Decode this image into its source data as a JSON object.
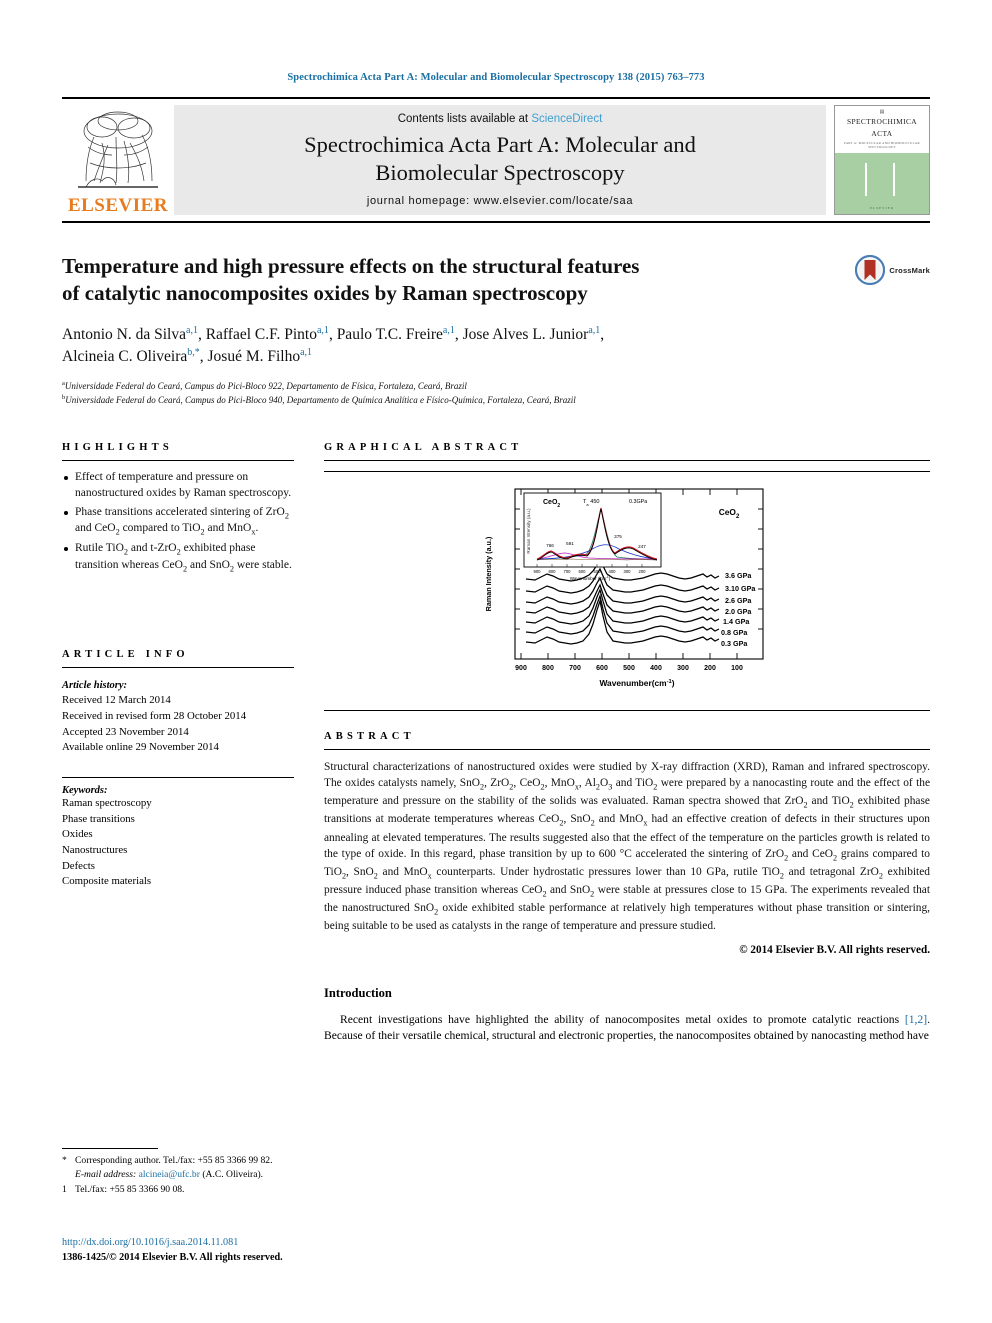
{
  "running_head": "Spectrochimica Acta Part A: Molecular and Biomolecular Spectroscopy 138 (2015) 763–773",
  "masthead": {
    "publisher": "ELSEVIER",
    "contents_prefix": "Contents lists available at ",
    "contents_link": "ScienceDirect",
    "journal_title_line1": "Spectrochimica Acta Part A: Molecular and",
    "journal_title_line2": "Biomolecular Spectroscopy",
    "homepage": "journal homepage: www.elsevier.com/locate/saa",
    "cover": {
      "title_line1": "SPECTROCHIMICA",
      "title_line2": "ACTA",
      "subtitle": "PART A: MOLECULAR AND BIOMOLECULAR SPECTROSCOPY",
      "footer": "ELSEVIER"
    }
  },
  "article": {
    "title_line1": "Temperature and high pressure effects on the structural features",
    "title_line2": "of catalytic nanocomposites oxides by Raman spectroscopy",
    "crossmark_label": "CrossMark",
    "authors": [
      {
        "name": "Antonio N. da Silva",
        "marks": "a,1",
        "sep": ", "
      },
      {
        "name": "Raffael C.F. Pinto",
        "marks": "a,1",
        "sep": ", "
      },
      {
        "name": "Paulo T.C. Freire",
        "marks": "a,1",
        "sep": ", "
      },
      {
        "name": "Jose Alves L. Junior",
        "marks": "a,1",
        "sep": ", "
      },
      {
        "name": "Alcineia C. Oliveira",
        "marks": "b,*",
        "sep": ", "
      },
      {
        "name": "Josué M. Filho",
        "marks": "a,1",
        "sep": ""
      }
    ],
    "affiliations": [
      {
        "mark": "a",
        "text": "Universidade Federal do Ceará, Campus do Pici-Bloco 922, Departamento de Física, Fortaleza, Ceará, Brazil"
      },
      {
        "mark": "b",
        "text": "Universidade Federal do Ceará, Campus do Pici-Bloco 940, Departamento de Química Analítica e Físico-Química, Fortaleza, Ceará, Brazil"
      }
    ]
  },
  "highlights": {
    "heading": "HIGHLIGHTS",
    "items": [
      "Effect of temperature and pressure on nanostructured oxides by Raman spectroscopy.",
      "Phase transitions accelerated sintering of ZrO2 and CeO2 compared to TiO2 and MnOx.",
      "Rutile TiO2 and t-ZrO2 exhibited phase transition whereas CeO2 and SnO2 were stable."
    ]
  },
  "graphical_abstract": {
    "heading": "GRAPHICAL ABSTRACT"
  },
  "article_info": {
    "heading": "ARTICLE INFO",
    "history_label": "Article history:",
    "history": [
      "Received 12 March 2014",
      "Received in revised form 28 October 2014",
      "Accepted 23 November 2014",
      "Available online 29 November 2014"
    ],
    "keywords_label": "Keywords:",
    "keywords": [
      "Raman spectroscopy",
      "Phase transitions",
      "Oxides",
      "Nanostructures",
      "Defects",
      "Composite materials"
    ]
  },
  "abstract": {
    "heading": "ABSTRACT",
    "body": "Structural characterizations of nanostructured oxides were studied by X-ray diffraction (XRD), Raman and infrared spectroscopy. The oxides catalysts namely, SnO2, ZrO2, CeO2, MnOx, Al2O3 and TiO2 were prepared by a nanocasting route and the effect of the temperature and pressure on the stability of the solids was evaluated. Raman spectra showed that ZrO2 and TiO2 exhibited phase transitions at moderate temperatures whereas CeO2, SnO2 and MnOx had an effective creation of defects in their structures upon annealing at elevated temperatures. The results suggested also that the effect of the temperature on the particles growth is related to the type of oxide. In this regard, phase transition by up to 600 °C accelerated the sintering of ZrO2 and CeO2 grains compared to TiO2, SnO2 and MnOx counterparts. Under hydrostatic pressures lower than 10 GPa, rutile TiO2 and tetragonal ZrO2 exhibited pressure induced phase transition whereas CeO2 and SnO2 were stable at pressures close to 15 GPa. The experiments revealed that the nanostructured SnO2 oxide exhibited stable performance at relatively high temperatures without phase transition or sintering, being suitable to be used as catalysts in the range of temperature and pressure studied.",
    "copyright": "© 2014 Elsevier B.V. All rights reserved."
  },
  "introduction": {
    "heading": "Introduction",
    "paragraph_prefix": "Recent investigations have highlighted the ability of nanocomposites metal oxides to promote catalytic reactions ",
    "citation": "[1,2]",
    "paragraph_suffix": ". Because of their versatile chemical, structural and electronic properties, the nanocomposites obtained by nanocasting method have"
  },
  "footnotes": {
    "corresponding_mark": "*",
    "corresponding_text": "Corresponding author. Tel./fax: +55 85 3366 99 82.",
    "email_label": "E-mail address:",
    "email": "alcineia@ufc.br",
    "email_owner": "(A.C. Oliveira).",
    "note1_mark": "1",
    "note1_text": "Tel./fax: +55 85 3366 90 08."
  },
  "doi_block": {
    "doi": "http://dx.doi.org/10.1016/j.saa.2014.11.081",
    "issn": "1386-1425/© 2014 Elsevier B.V. All rights reserved."
  },
  "chart_data": {
    "type": "line",
    "title": "",
    "xlabel": "Wavenumber(cm-1)",
    "ylabel": "Raman Intensity (a.u.)",
    "sample_label": "CeO2",
    "xlim": [
      950,
      60
    ],
    "xticks": [
      900,
      800,
      700,
      600,
      500,
      400,
      300,
      200,
      100
    ],
    "series": [
      {
        "name": "3.6 GPa",
        "label": "3.6 GPa"
      },
      {
        "name": "3.1 GPa",
        "label": "3.10 GPa"
      },
      {
        "name": "2.6 GPa",
        "label": "2.6 GPa"
      },
      {
        "name": "2.0 GPa",
        "label": "2.0 GPa"
      },
      {
        "name": "1.4 GPa",
        "label": "1.4 GPa"
      },
      {
        "name": "0.8 GPa",
        "label": "0.8 GPa"
      },
      {
        "name": "0.3 GPa",
        "label": "0.3 GPa"
      }
    ],
    "main_peak_cm": 460,
    "inset": {
      "sample_label": "CeO2",
      "temp_label": "Ta 450",
      "pressure_label": "0.3GPa",
      "xlabel": "Wavenumber (cm-1)",
      "ylabel": "Raman Intensity (a.u.)",
      "xticks": [
        900,
        800,
        700,
        600,
        500,
        400,
        300,
        200
      ],
      "peak_labels": [
        "766",
        "591",
        "375",
        "247"
      ],
      "fit_colors": [
        "#d01020",
        "#1530c8",
        "#c020c0",
        "#108060"
      ]
    }
  }
}
